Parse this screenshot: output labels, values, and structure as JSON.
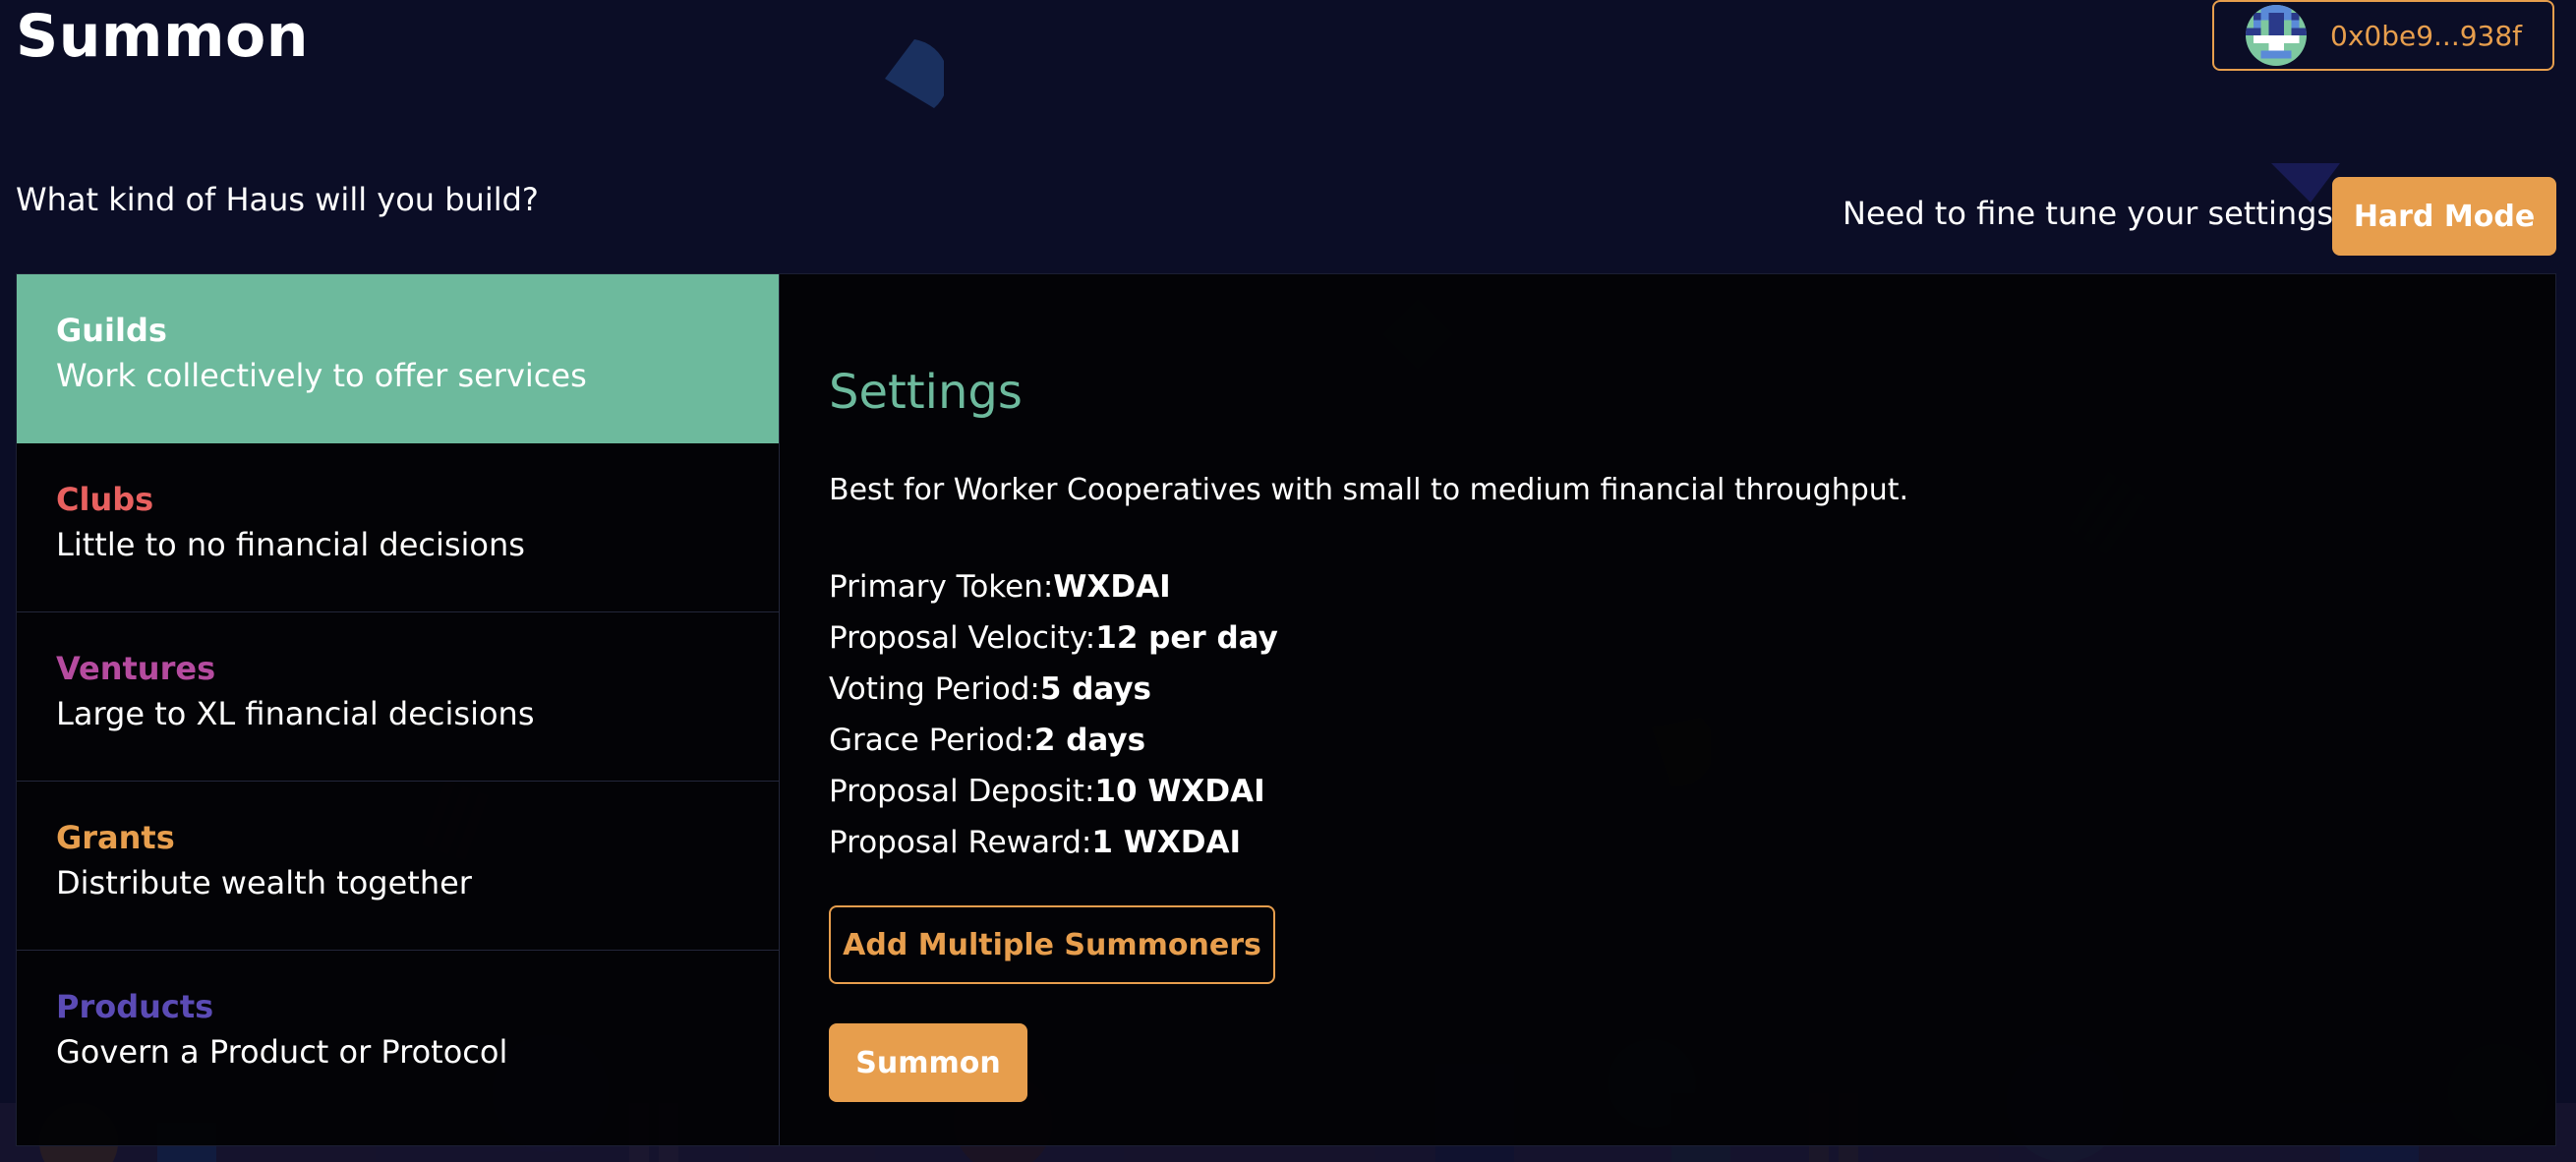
{
  "header": {
    "title": "Summon",
    "wallet": {
      "address": "0x0be9...938f",
      "avatar_icon": "pixel-avatar-icon"
    }
  },
  "subtitle": "What kind of Haus will you build?",
  "fine_tune": {
    "prompt": "Need to fine tune your settings?",
    "button_label": "Hard Mode"
  },
  "dao_types": [
    {
      "name": "Guilds",
      "description": "Work collectively to offer services",
      "color": "#ffffff",
      "active": true
    },
    {
      "name": "Clubs",
      "description": "Little to no financial decisions",
      "color": "#e8605f",
      "active": false
    },
    {
      "name": "Ventures",
      "description": "Large to XL financial decisions",
      "color": "#b54b9f",
      "active": false
    },
    {
      "name": "Grants",
      "description": "Distribute wealth together",
      "color": "#e79e4d",
      "active": false
    },
    {
      "name": "Products",
      "description": "Govern a Product or Protocol",
      "color": "#5b4bb5",
      "active": false
    }
  ],
  "settings": {
    "title": "Settings",
    "description": "Best for Worker Cooperatives with small to medium financial throughput.",
    "items": [
      {
        "label": "Primary Token:",
        "value": "WXDAI"
      },
      {
        "label": "Proposal Velocity:",
        "value": "12 per day"
      },
      {
        "label": "Voting Period:",
        "value": "5 days"
      },
      {
        "label": "Grace Period:",
        "value": "2 days"
      },
      {
        "label": "Proposal Deposit:",
        "value": "10 WXDAI"
      },
      {
        "label": "Proposal Reward:",
        "value": "1 WXDAI"
      }
    ],
    "add_summoners_label": "Add Multiple Summoners",
    "summon_label": "Summon"
  },
  "colors": {
    "background": "#0b0d26",
    "accent_orange": "#e79e4d",
    "accent_green": "#6dba9d"
  }
}
